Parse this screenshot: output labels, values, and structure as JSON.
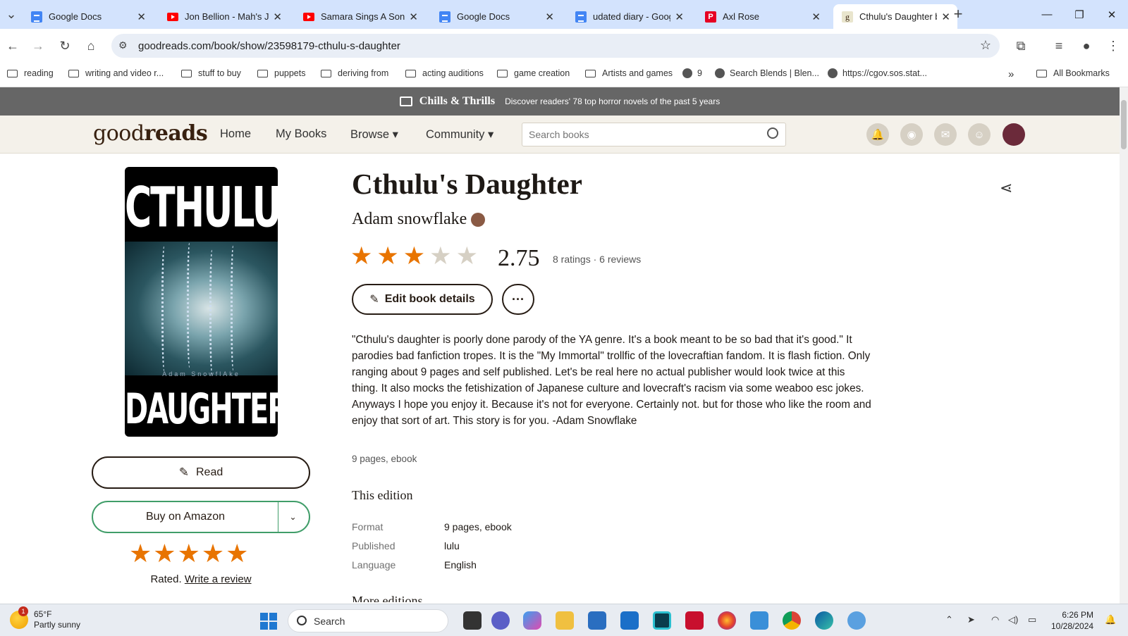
{
  "browser": {
    "tabs": [
      {
        "label": "Google Docs",
        "icon": "google-docs-icon",
        "kind": "doc"
      },
      {
        "label": "Jon Bellion - Mah's Jo",
        "icon": "youtube-icon",
        "kind": "yt"
      },
      {
        "label": "Samara Sings A Song",
        "icon": "youtube-icon",
        "kind": "yt"
      },
      {
        "label": "Google Docs",
        "icon": "google-docs-icon",
        "kind": "doc"
      },
      {
        "label": "udated diary - Googl",
        "icon": "google-docs-icon",
        "kind": "doc"
      },
      {
        "label": "Axl Rose",
        "icon": "pinterest-icon",
        "kind": "pin"
      },
      {
        "label": "Cthulu's Daughter by",
        "icon": "goodreads-icon",
        "kind": "gr",
        "active": true
      }
    ],
    "url": "goodreads.com/book/show/23598179-cthulu-s-daughter",
    "bookmarks": [
      {
        "label": "reading",
        "icon": "folder-icon"
      },
      {
        "label": "writing and video r...",
        "icon": "folder-icon"
      },
      {
        "label": "stuff to buy",
        "icon": "folder-icon"
      },
      {
        "label": "puppets",
        "icon": "folder-icon"
      },
      {
        "label": "deriving from",
        "icon": "folder-icon"
      },
      {
        "label": "acting auditions",
        "icon": "folder-icon"
      },
      {
        "label": "game creation",
        "icon": "folder-icon"
      },
      {
        "label": "Artists and games",
        "icon": "folder-icon"
      },
      {
        "label": "9",
        "icon": "globe-icon"
      },
      {
        "label": "Search Blends | Blen...",
        "icon": "globe-icon"
      },
      {
        "label": "https://cgov.sos.stat...",
        "icon": "globe-icon"
      }
    ],
    "all_bookmarks": "All Bookmarks"
  },
  "promo": {
    "title": "Chills & Thrills",
    "text": "Discover readers' 78 top horror novels of the past 5 years"
  },
  "nav": {
    "logo_light": "good",
    "logo_bold": "reads",
    "home": "Home",
    "my_books": "My Books",
    "browse": "Browse ▾",
    "community": "Community ▾",
    "search_placeholder": "Search books"
  },
  "book": {
    "title": "Cthulu's Daughter",
    "author": "Adam snowflake",
    "avg_rating": "2.75",
    "rating_value": 2.75,
    "counts": "8 ratings · 6 reviews",
    "edit_label": "Edit book details",
    "more_label": "···",
    "description": "\"Cthulu's daughter is poorly done parody of the YA genre. It's a book meant to be so bad that it's good.\" It parodies bad fanfiction tropes. It is the \"My Immortal\" trollfic of the lovecraftian fandom. It is flash fiction. Only ranging about 9 pages and self published. Let's be real here no actual publisher would look twice at this thing. It also mocks the fetishization of Japanese culture and lovecraft's racism via some weaboo esc jokes. Anyways I hope you enjoy it. Because it's not for everyone. Certainly not. but for those who like the room and enjoy that sort of art. This story is for you. -Adam Snowflake",
    "pages_line": "9 pages, ebook",
    "cover_top": "CTHULU'S",
    "cover_author": "Adam SnowflAke",
    "cover_bottom": "DAUGHTER"
  },
  "sidebar": {
    "read_label": "Read",
    "buy_label": "Buy on Amazon",
    "user_rating": 5,
    "rated_label": "Rated.",
    "write_review": "Write a review"
  },
  "edition": {
    "heading": "This edition",
    "rows": [
      {
        "key": "Format",
        "value": "9 pages, ebook"
      },
      {
        "key": "Published",
        "value": "lulu"
      },
      {
        "key": "Language",
        "value": "English"
      }
    ],
    "more_editions": "More editions"
  },
  "taskbar": {
    "weather_temp": "65°F",
    "weather_desc": "Partly sunny",
    "weather_badge": "1",
    "search_label": "Search",
    "time": "6:26 PM",
    "date": "10/28/2024"
  },
  "colors": {
    "star_filled": "#e87400",
    "star_empty": "#d6d0c4",
    "goodreads_brown": "#382110",
    "amazon_border": "#409d69"
  }
}
